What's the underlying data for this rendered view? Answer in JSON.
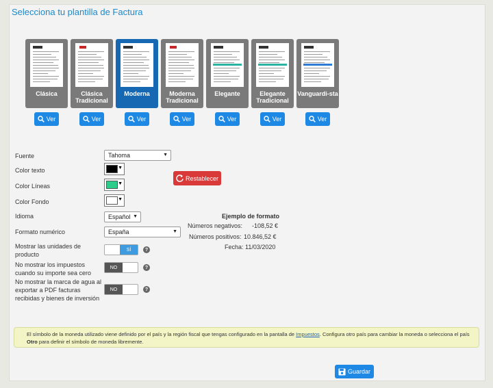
{
  "page": {
    "title": "Selecciona tu plantilla de Factura"
  },
  "templates": [
    {
      "name": "Clásica",
      "selected": false,
      "view_label": "Ver"
    },
    {
      "name": "Clásica Tradicional",
      "selected": false,
      "view_label": "Ver"
    },
    {
      "name": "Moderna",
      "selected": true,
      "view_label": "Ver"
    },
    {
      "name": "Moderna Tradicional",
      "selected": false,
      "view_label": "Ver"
    },
    {
      "name": "Elegante",
      "selected": false,
      "view_label": "Ver"
    },
    {
      "name": "Elegante Tradicional",
      "selected": false,
      "view_label": "Ver"
    },
    {
      "name": "Vanguardi-sta",
      "selected": false,
      "view_label": "Ver"
    }
  ],
  "settings": {
    "font": {
      "label": "Fuente",
      "value": "Tahoma"
    },
    "text_color": {
      "label": "Color texto",
      "value": "#000000"
    },
    "line_color": {
      "label": "Color Líneas",
      "value": "#2ecc8a"
    },
    "bg_color": {
      "label": "Color Fondo",
      "value": "#ffffff"
    },
    "reset_label": "Restablecer",
    "language": {
      "label": "Idioma",
      "value": "Español"
    },
    "number_format": {
      "label": "Formato numérico",
      "value": "España"
    },
    "show_units": {
      "label": "Mostrar las unidades de producto",
      "value": "SÍ"
    },
    "hide_taxes": {
      "label": "No mostrar los impuestos cuando su importe sea cero",
      "value": "NO"
    },
    "hide_watermark": {
      "label": "No mostrar la marca de agua al exportar a PDF facturas recibidas y bienes de inversión",
      "value": "NO"
    }
  },
  "format_example": {
    "title": "Ejemplo de formato",
    "negative_label": "Números negativos:",
    "negative_value": "-108,52 €",
    "positive_label": "Números positivos:",
    "positive_value": "10.846,52 €",
    "date_label": "Fecha:",
    "date_value": "11/03/2020"
  },
  "notice": {
    "text_before": "El símbolo de la moneda utilizado viene definido por el país y la región fiscal que tengas configurado en la pantalla de ",
    "link": "Impuestos",
    "text_middle": ". Configura otro país para cambiar la moneda o selecciona el país ",
    "bold": "Otro",
    "text_after": " para definir el símbolo de moneda libremente."
  },
  "save_label": "Guardar",
  "icons": {
    "view": "search-icon",
    "reset": "refresh-icon",
    "save": "save-icon",
    "help": "help-icon"
  }
}
